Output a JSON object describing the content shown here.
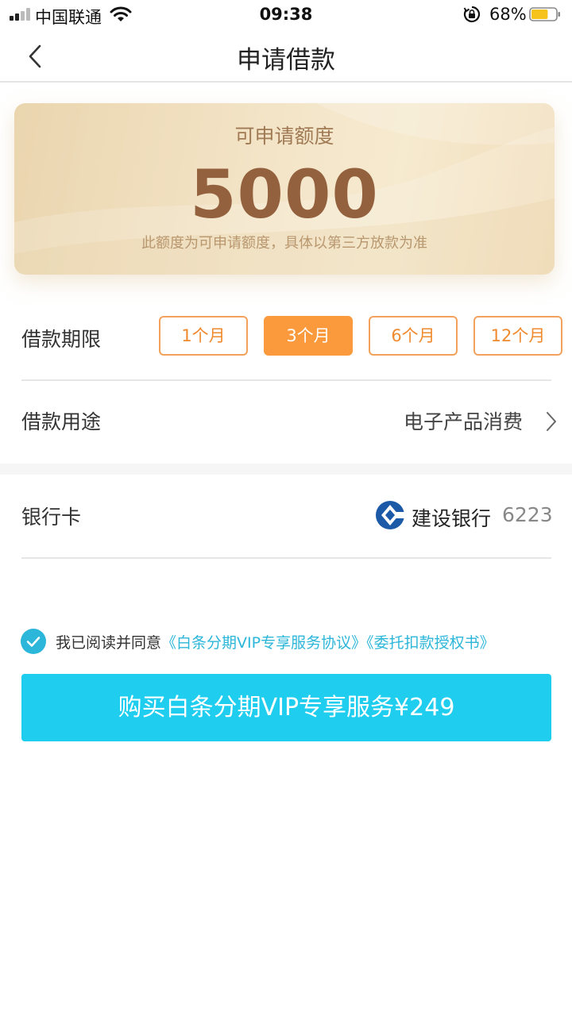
{
  "status_bar": {
    "carrier": "中国联通",
    "time": "09:38",
    "battery_percent": "68%",
    "battery_level": 0.68,
    "icons": [
      "signal-icon",
      "wifi-icon",
      "orientation-lock-icon",
      "battery-icon"
    ]
  },
  "nav": {
    "title": "申请借款",
    "back_icon": "chevron-left-icon"
  },
  "quota": {
    "label": "可申请额度",
    "amount": "5000",
    "note": "此额度为可申请额度，具体以第三方放款为准"
  },
  "loan_term": {
    "label": "借款期限",
    "options": [
      "1个月",
      "3个月",
      "6个月",
      "12个月"
    ],
    "selected": "3个月"
  },
  "loan_purpose": {
    "label": "借款用途",
    "value": "电子产品消费"
  },
  "bank_card": {
    "label": "银行卡",
    "bank_name": "建设银行",
    "card_tail": "6223"
  },
  "agreement": {
    "prefix": "我已阅读并同意",
    "link_1": "《白条分期VIP专享服务协议》",
    "link_2": "《委托扣款授权书》",
    "checked": true
  },
  "buy_button": {
    "label": "购买白条分期VIP专享服务¥249"
  },
  "colors": {
    "accent_orange": "#fb9a3c",
    "accent_cyan": "#1fcdef",
    "link_blue": "#2cb6d9",
    "quota_brown": "#94613e"
  }
}
